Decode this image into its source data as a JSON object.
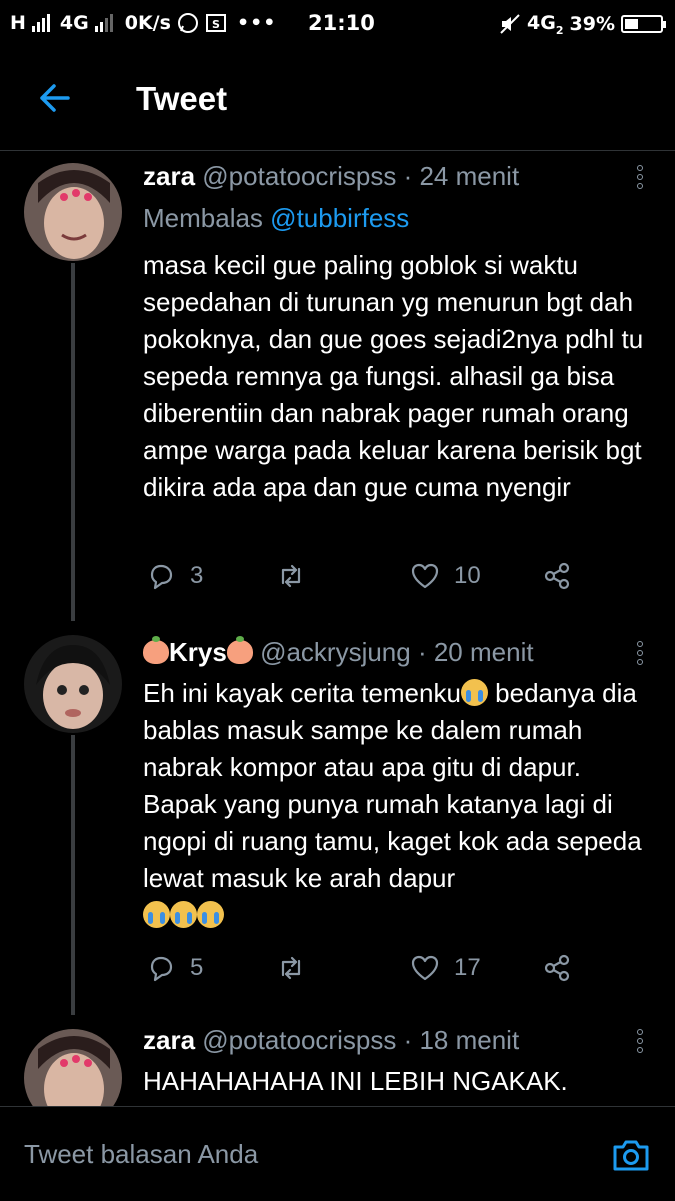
{
  "status_bar": {
    "network_left": "H",
    "network_mid": "4G",
    "speed": "0K/s",
    "time": "21:10",
    "network_right": "4G",
    "network_right_sub": "2",
    "battery_pct": "39%",
    "battery_level": 0.39
  },
  "header": {
    "title": "Tweet"
  },
  "tweets": [
    {
      "name": "zara",
      "handle": "@potatoocrispss",
      "time": "· 24 menit",
      "replying_prefix": "Membalas",
      "replying_to": "@tubbirfess",
      "text": "masa kecil gue paling goblok si waktu sepedahan di turunan yg menurun bgt dah pokoknya, dan gue goes sejadi2nya pdhl tu sepeda remnya ga fungsi. alhasil ga bisa diberentiin dan nabrak pager rumah orang ampe warga pada keluar karena berisik bgt dikira ada apa dan gue cuma nyengir",
      "replies": "3",
      "likes": "10"
    },
    {
      "name": "Krys",
      "handle": "@ackrysjung",
      "time": "· 20 menit",
      "text_1": "Eh ini kayak cerita temenku",
      "text_2": " bedanya dia bablas masuk sampe ke dalem rumah nabrak kompor atau apa gitu di dapur. Bapak yang punya rumah katanya lagi di ngopi di ruang tamu, kaget kok ada sepeda lewat masuk ke arah dapur",
      "replies": "5",
      "likes": "17"
    },
    {
      "name": "zara",
      "handle": "@potatoocrispss",
      "time": "· 18 menit",
      "text": "HAHAHAHAHA INI LEBIH NGAKAK."
    }
  ],
  "reply_bar": {
    "placeholder": "Tweet balasan Anda"
  },
  "colors": {
    "accent": "#1d9bf0",
    "muted": "#8b98a5",
    "background": "#000000"
  },
  "icons": [
    "back-arrow-icon",
    "more-icon",
    "reply-icon",
    "retweet-icon",
    "like-icon",
    "share-icon",
    "camera-icon",
    "crying-emoji-icon",
    "peach-emoji-icon"
  ]
}
